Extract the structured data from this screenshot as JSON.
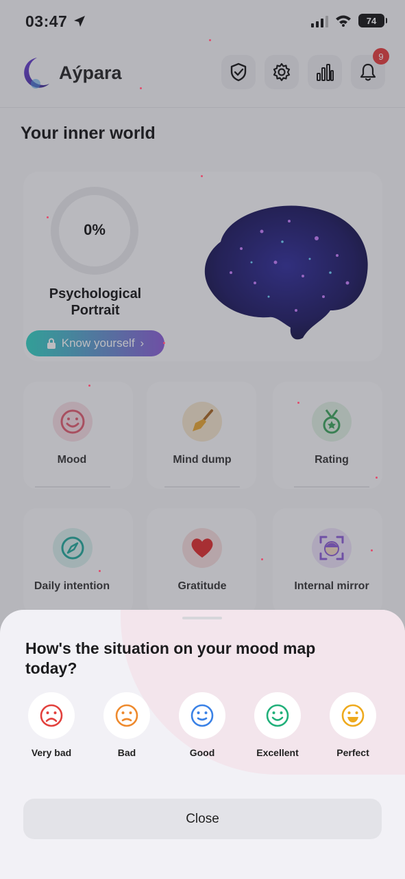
{
  "status_bar": {
    "time": "03:47",
    "battery": "74"
  },
  "header": {
    "app_title": "Aýpara",
    "notification_count": "9",
    "icons": [
      "shield-check-icon",
      "gear-icon",
      "bar-chart-icon",
      "bell-icon"
    ]
  },
  "main": {
    "section_title": "Your inner world",
    "portrait": {
      "percent_text": "0%",
      "progress": 0,
      "label": "Psychological Portrait",
      "button_label": "Know yourself",
      "button_arrow": "›"
    },
    "tiles": [
      {
        "label": "Mood",
        "icon": "smile-icon",
        "color": "#e15a6e"
      },
      {
        "label": "Mind dump",
        "icon": "broom-icon",
        "color": "#e09a2b"
      },
      {
        "label": "Rating",
        "icon": "medal-icon",
        "color": "#3aa55a"
      },
      {
        "label": "Daily intention",
        "icon": "compass-icon",
        "color": "#1fa99a"
      },
      {
        "label": "Gratitude",
        "icon": "heart-icon",
        "color": "#e02a2a"
      },
      {
        "label": "Internal mirror",
        "icon": "face-scan-icon",
        "color": "#8b5bd6"
      }
    ]
  },
  "sheet": {
    "title": "How's the situation on your mood map today?",
    "moods": [
      {
        "label": "Very bad",
        "icon": "very-sad-face-icon",
        "color": "#e2413d"
      },
      {
        "label": "Bad",
        "icon": "sad-face-icon",
        "color": "#ee8a2e"
      },
      {
        "label": "Good",
        "icon": "neutral-smile-icon",
        "color": "#3b82e6"
      },
      {
        "label": "Excellent",
        "icon": "smile-face-icon",
        "color": "#21b07a"
      },
      {
        "label": "Perfect",
        "icon": "grin-face-icon",
        "color": "#eeaa1e"
      }
    ],
    "close_label": "Close"
  }
}
